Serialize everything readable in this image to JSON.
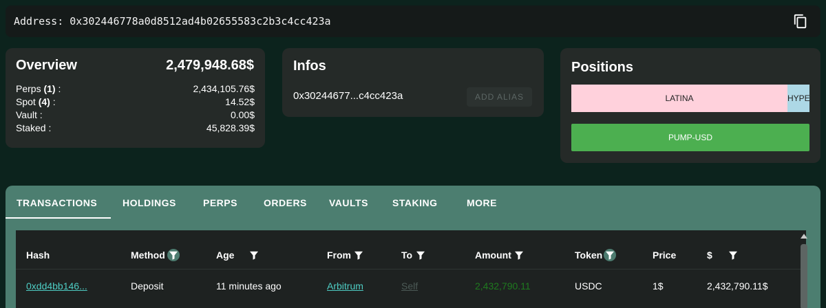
{
  "address_bar": {
    "label": "Address: 0x302446778a0d8512ad4b02655583c2b3c4cc423a",
    "copy_icon": "copy-icon"
  },
  "overview": {
    "title": "Overview",
    "total": "2,479,948.68$",
    "rows": [
      {
        "label_pre": "Perps ",
        "count": "(1)",
        "label_post": " :",
        "value": "2,434,105.76$"
      },
      {
        "label_pre": "Spot ",
        "count": "(4)",
        "label_post": " :",
        "value": "14.52$"
      },
      {
        "label_pre": "Vault :",
        "count": "",
        "label_post": "",
        "value": "0.00$"
      },
      {
        "label_pre": "Staked :",
        "count": "",
        "label_post": "",
        "value": "45,828.39$"
      }
    ]
  },
  "infos": {
    "title": "Infos",
    "address_short": "0x30244677...c4cc423a",
    "add_alias_label": "ADD ALIAS"
  },
  "positions": {
    "title": "Positions",
    "bars": [
      {
        "label": "LATINA",
        "color": "#ffd1dc"
      },
      {
        "label": "HYPE",
        "color": "#add8e6"
      },
      {
        "label": "PUMP-USD",
        "color": "#4caf50"
      }
    ]
  },
  "tabs": [
    {
      "label": "TRANSACTIONS",
      "active": true
    },
    {
      "label": "HOLDINGS",
      "active": false
    },
    {
      "label": "PERPS",
      "active": false
    },
    {
      "label": "ORDERS",
      "active": false
    },
    {
      "label": "VAULTS",
      "active": false
    },
    {
      "label": "STAKING",
      "active": false
    },
    {
      "label": "MORE",
      "active": false
    }
  ],
  "table": {
    "columns": [
      "Hash",
      "Method",
      "Age",
      "From",
      "To",
      "Amount",
      "Token",
      "Price",
      "$"
    ],
    "rows": [
      {
        "hash": "0xdd4bb146...",
        "method": "Deposit",
        "age": "11 minutes ago",
        "from": "Arbitrum",
        "to": "Self",
        "amount": "2,432,790.11",
        "token": "USDC",
        "price": "1$",
        "usd": "2,432,790.11$"
      }
    ]
  },
  "colors": {
    "background": "#0c231d",
    "card": "#252a28",
    "tab_bar": "#4c7e70",
    "link": "#4ecdc4",
    "amount_green": "#1f7a1f"
  }
}
